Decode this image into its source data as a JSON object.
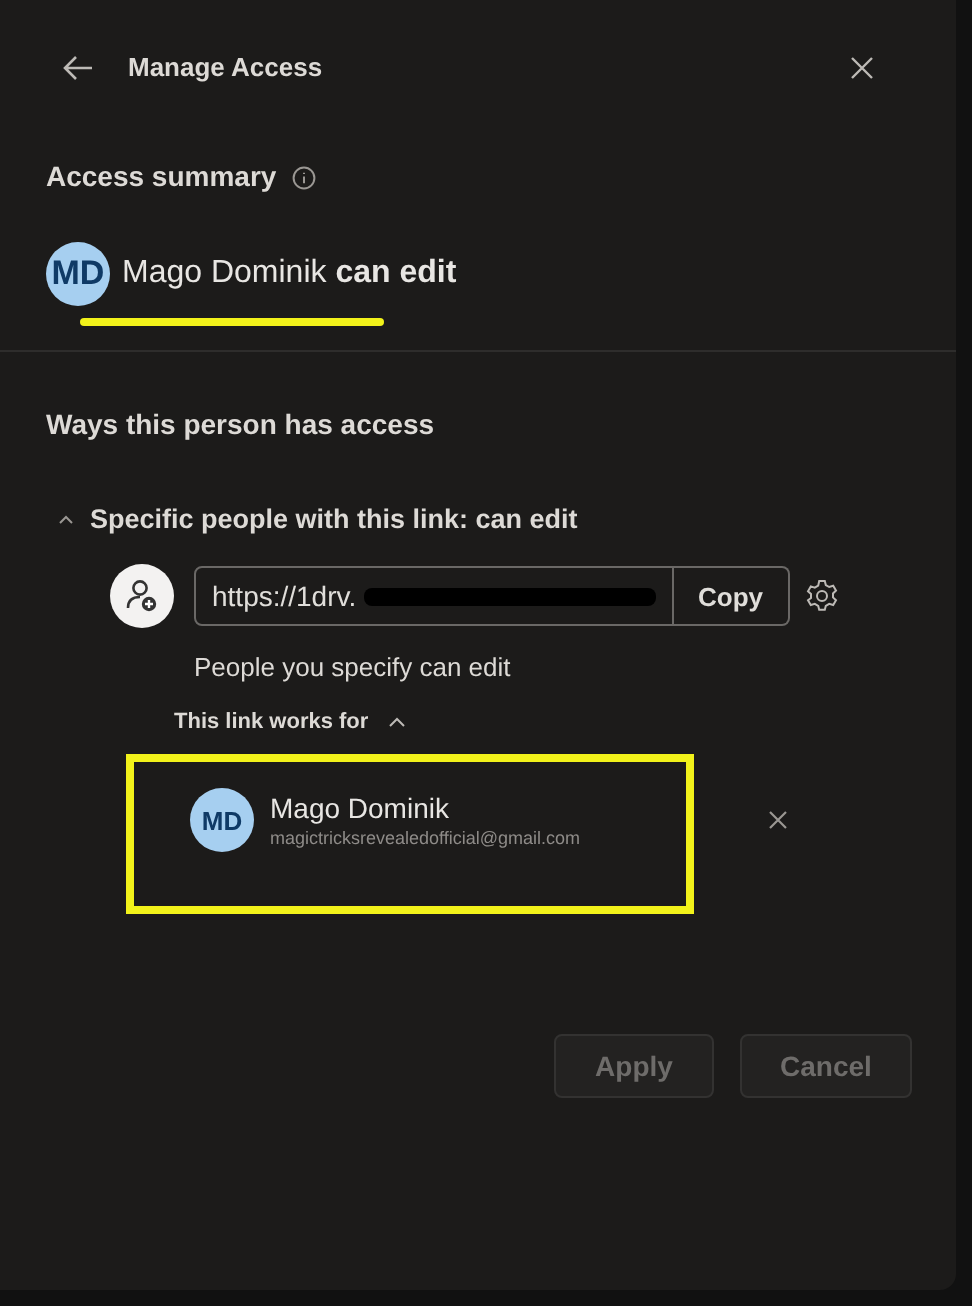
{
  "header": {
    "title": "Manage Access"
  },
  "access_summary": {
    "heading": "Access summary",
    "person": {
      "initials": "MD",
      "text": "Mago Dominik **can edit**",
      "underlined": true
    }
  },
  "ways": {
    "heading": "Ways this person has access",
    "sections": [
      {
        "title": "Specific people with this link: can edit",
        "expanded": true,
        "link": {
          "url": "https://1drv.",
          "redacted": true
        },
        "copy_label": "Copy",
        "description": "People you specify can edit",
        "works_for": {
          "label": "This link works for",
          "expanded": true,
          "people": [
            {
              "initials": "MD",
              "name": "Mago Dominik",
              "email": "magictricksrevealedofficial@gmail.com",
              "highlighted": true
            }
          ]
        }
      }
    ]
  },
  "buttons": [
    {
      "label": "Apply",
      "disabled": true
    },
    {
      "label": "Cancel",
      "disabled": true
    }
  ]
}
